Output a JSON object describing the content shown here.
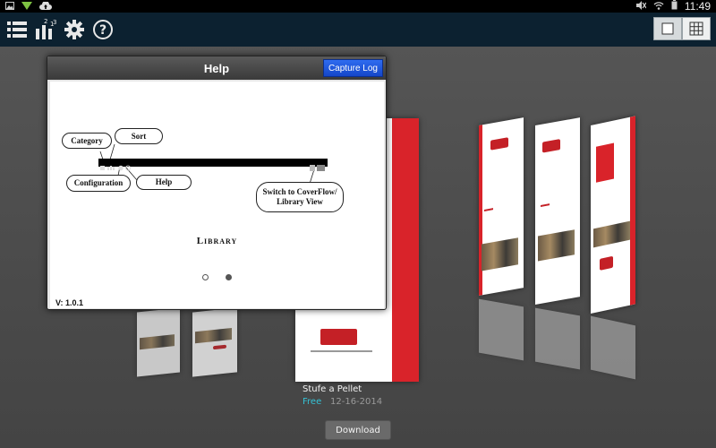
{
  "status_bar": {
    "time": "11:49",
    "icons": [
      "image-icon",
      "wifi-icon",
      "cloud-upload-icon",
      "mute-icon",
      "wifi-icon",
      "battery-icon"
    ]
  },
  "toolbar": {
    "icons": [
      "category-list-icon",
      "sort-icon",
      "settings-gear-icon",
      "help-icon"
    ],
    "view_toggle": [
      "coverflow-view-icon",
      "grid-view-icon"
    ],
    "active_view": "coverflow"
  },
  "help_dialog": {
    "title": "Help",
    "capture_button": "Capture Log",
    "callouts": {
      "category": "Category",
      "sort": "Sort",
      "configuration": "Configuration",
      "help": "Help",
      "switch_line1": "Switch to CoverFlow/",
      "switch_line2": "Library View"
    },
    "section_label": "Library",
    "page_count": 2,
    "current_page": 2,
    "version": "V: 1.0.1"
  },
  "featured_book": {
    "title": "Stufe a Pellet",
    "price": "Free",
    "date": "12-16-2014"
  },
  "download_button": "Download",
  "colors": {
    "statusbar_bg": "#000000",
    "actionbar_bg": "#0c2130",
    "accent_free": "#35c2d6",
    "brand_red": "#d9232a",
    "capture_button": "#1f5ae0"
  }
}
